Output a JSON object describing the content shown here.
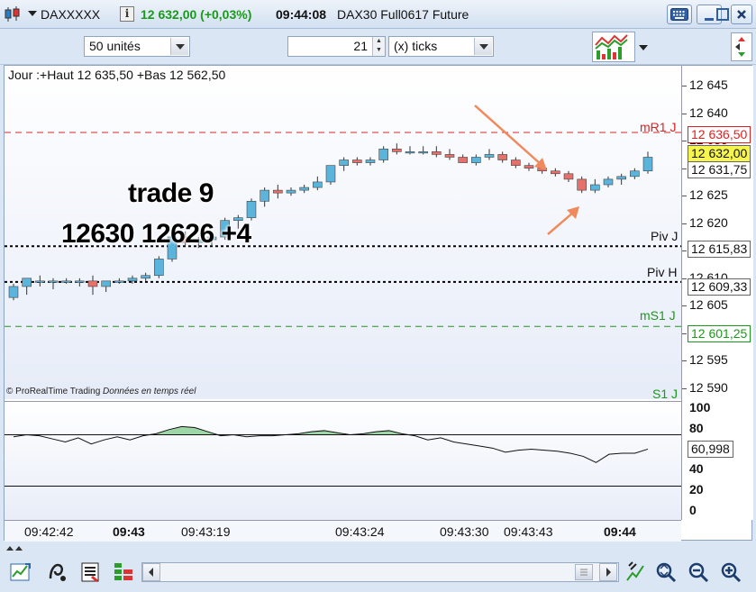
{
  "window": {
    "symbol": "DAXXXXX",
    "info_icon": "i",
    "last_price": "12 632,00 (+0,03%)",
    "time": "09:44:08",
    "instrument": "DAX30 Full0617 Future",
    "buttons": [
      "keyboard-icon",
      "minimize-icon",
      "restore-icon",
      "close-icon"
    ],
    "accent_green": "#1a9a1a"
  },
  "toolbar": {
    "units_value": "50 unités",
    "ticks_value": "21",
    "ticks_unit": "(x) ticks"
  },
  "chart": {
    "header": "Jour :+Haut 12 635,50 +Bas 12 562,50",
    "watermark_brand": "© ProRealTime Trading",
    "watermark_note": "Données en temps réel",
    "trade_line1": "trade 9",
    "trade_line2": "12630 12626 +4",
    "levels": {
      "mR1": {
        "label": "mR1 J",
        "value": "12 636,50",
        "color": "#e02020"
      },
      "last": {
        "value": "12 632,00"
      },
      "current": {
        "value": "12 631,75"
      },
      "pivJ": {
        "label": "Piv J",
        "value": "12 615,83"
      },
      "pivH": {
        "label": "Piv H",
        "value": "12 609,33"
      },
      "mS1": {
        "label": "mS1 J",
        "value": "12 601,25",
        "color": "#1a9a1a"
      },
      "S1": {
        "label": "S1 J"
      }
    },
    "price_ticks": [
      "12 645",
      "12 640",
      "12 635",
      "12 630",
      "12 625",
      "12 620",
      "12 615",
      "12 610",
      "12 605",
      "12 600",
      "12 595",
      "12 590"
    ],
    "time_labels": [
      {
        "text": "09:42:42",
        "bold": false
      },
      {
        "text": "09:43",
        "bold": true
      },
      {
        "text": "09:43:19",
        "bold": false
      },
      {
        "text": "09:43:24",
        "bold": false
      },
      {
        "text": "09:43:30",
        "bold": false
      },
      {
        "text": "09:43:43",
        "bold": false
      },
      {
        "text": "09:44",
        "bold": true
      }
    ],
    "oscillator": {
      "value": "60,998",
      "ticks": [
        "100",
        "80",
        "60",
        "40",
        "20",
        "0"
      ],
      "upper_level": 75,
      "lower_level": 25
    },
    "colors": {
      "up": "#5ab4dc",
      "down": "#e8706a",
      "pivot": "#000000"
    }
  },
  "chart_data": {
    "type": "candlestick",
    "title": "",
    "xlabel": "",
    "ylabel": "",
    "ylim": [
      12588.5,
      12648
    ],
    "x_labels": [
      "09:42:42",
      "09:43",
      "09:43:19",
      "09:43:24",
      "09:43:30",
      "09:43:43",
      "09:44"
    ],
    "ohlc": [
      [
        12606.5,
        12609,
        12606,
        12608.5
      ],
      [
        12608.5,
        12610,
        12607,
        12610
      ],
      [
        12609.5,
        12610.5,
        12608.5,
        12609.5
      ],
      [
        12609.5,
        12610,
        12608,
        12609.5
      ],
      [
        12609.5,
        12610,
        12609,
        12609.5
      ],
      [
        12609.5,
        12610,
        12608.5,
        12609.5
      ],
      [
        12609.5,
        12610.5,
        12607,
        12608.5
      ],
      [
        12608.5,
        12609.5,
        12607.5,
        12609.5
      ],
      [
        12609.5,
        12610,
        12609,
        12609.5
      ],
      [
        12609.5,
        12610.5,
        12609,
        12610
      ],
      [
        12610,
        12611,
        12609.5,
        12610.5
      ],
      [
        12610.5,
        12614,
        12610,
        12613.5
      ],
      [
        12613.5,
        12618.5,
        12613,
        12617.5
      ],
      [
        12617.5,
        12618.5,
        12616,
        12616.5
      ],
      [
        12616.5,
        12617.5,
        12615.5,
        12617
      ],
      [
        12617,
        12618,
        12616,
        12617.5
      ],
      [
        12617.5,
        12621,
        12617,
        12620.5
      ],
      [
        12620.5,
        12621.5,
        12619,
        12621
      ],
      [
        12621,
        12624.5,
        12620.5,
        12624
      ],
      [
        12624,
        12626.5,
        12623,
        12626
      ],
      [
        12626,
        12627,
        12624.5,
        12625.5
      ],
      [
        12625.5,
        12626.5,
        12625,
        12626
      ],
      [
        12626,
        12627,
        12625.5,
        12626.5
      ],
      [
        12626.5,
        12628.5,
        12626,
        12627.5
      ],
      [
        12627.5,
        12630.5,
        12627,
        12630.5
      ],
      [
        12630.5,
        12632,
        12629.5,
        12631.5
      ],
      [
        12631.5,
        12632,
        12630.5,
        12631
      ],
      [
        12631,
        12632,
        12630.5,
        12631.5
      ],
      [
        12631.5,
        12634,
        12631,
        12633.5
      ],
      [
        12633.5,
        12634.5,
        12632.5,
        12633
      ],
      [
        12633,
        12634,
        12632.5,
        12633
      ],
      [
        12633,
        12634,
        12632.5,
        12633
      ],
      [
        12633,
        12634,
        12632,
        12632.5
      ],
      [
        12632.5,
        12633.5,
        12631.5,
        12632
      ],
      [
        12632,
        12632.5,
        12631,
        12631
      ],
      [
        12631,
        12632.5,
        12630.5,
        12632
      ],
      [
        12632,
        12633.5,
        12631.5,
        12632.5
      ],
      [
        12632.5,
        12633,
        12631,
        12631.5
      ],
      [
        12631.5,
        12632,
        12630,
        12630.5
      ],
      [
        12630.5,
        12631,
        12629.5,
        12630
      ],
      [
        12630,
        12630.5,
        12629,
        12629.5
      ],
      [
        12629.5,
        12630,
        12628.5,
        12629
      ],
      [
        12629,
        12629.5,
        12627.5,
        12628
      ],
      [
        12628,
        12628.5,
        12625.5,
        12626
      ],
      [
        12626,
        12628,
        12625.5,
        12627
      ],
      [
        12627,
        12628.5,
        12626.5,
        12628
      ],
      [
        12628,
        12629,
        12627,
        12628.5
      ],
      [
        12628.5,
        12630,
        12628,
        12629.5
      ],
      [
        12629.5,
        12633,
        12629,
        12632
      ]
    ],
    "horizontal_lines": [
      {
        "label": "mR1 J",
        "value": 12636.5,
        "style": "dashed",
        "color": "#e02020"
      },
      {
        "label": "Piv J",
        "value": 12615.83,
        "style": "dotted",
        "color": "#000000"
      },
      {
        "label": "Piv H",
        "value": 12609.33,
        "style": "dotted",
        "color": "#000000"
      },
      {
        "label": "mS1 J",
        "value": 12601.25,
        "style": "dashed",
        "color": "#1a9a1a"
      }
    ],
    "oscillator": {
      "type": "line",
      "ylim": [
        0,
        100
      ],
      "levels": [
        75,
        25
      ],
      "values": [
        73,
        75,
        74,
        71,
        68,
        72,
        66,
        70,
        73,
        70,
        74,
        76,
        80,
        83,
        82,
        78,
        74,
        75,
        73,
        74,
        74,
        75,
        76,
        78,
        79,
        77,
        75,
        76,
        78,
        79,
        76,
        74,
        70,
        72,
        68,
        66,
        64,
        62,
        58,
        60,
        61,
        60,
        59,
        57,
        54,
        48,
        56,
        57,
        57,
        61
      ]
    }
  }
}
